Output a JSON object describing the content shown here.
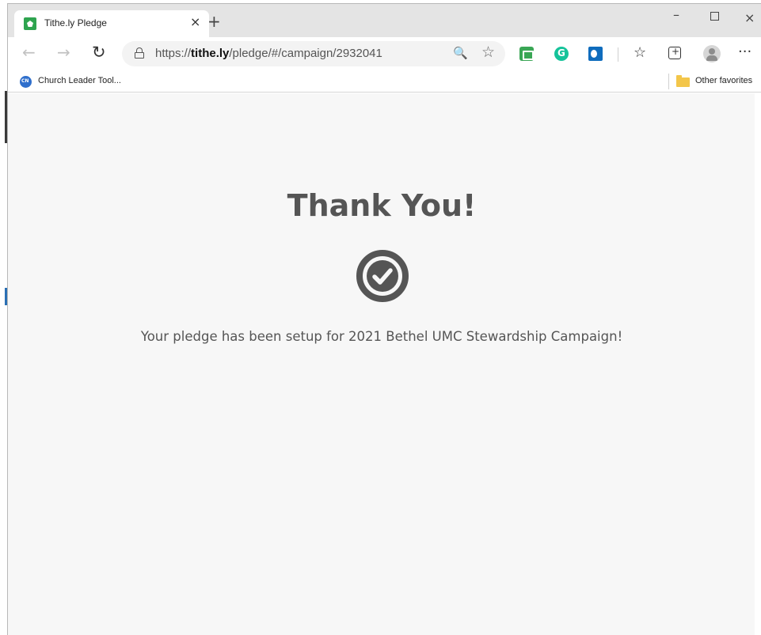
{
  "browser": {
    "tab_title": "Tithe.ly Pledge",
    "tab_close_glyph": "×",
    "new_tab_glyph": "+",
    "window_controls": {
      "minimize": "–",
      "close": "×"
    },
    "url_plain_prefix": "https://",
    "url_domain": "tithe.ly",
    "url_path": "/pledge/#/campaign/2932041",
    "nav": {
      "back_glyph": "←",
      "forward_glyph": "→",
      "refresh_glyph": "↻"
    },
    "address_icons": {
      "zoom": "zoom-icon",
      "favorite": "star-icon"
    },
    "zoom_glyph": "🔍",
    "star_glyph": "☆",
    "favorites_glyph": "☆",
    "more_glyph": "···",
    "extensions": [
      "print-friendly-icon",
      "grammarly-icon",
      "outlook-icon"
    ],
    "favorites_bar": {
      "items": [
        {
          "label": "Church Leader Tool..."
        }
      ],
      "other_label": "Other favorites"
    }
  },
  "page": {
    "heading": "Thank You!",
    "message": "Your pledge has been setup for 2021 Bethel UMC Stewardship Campaign!",
    "icon": "check-circle-icon",
    "colors": {
      "text": "#555555",
      "background": "#f7f7f7",
      "favicon": "#2ea44f"
    }
  }
}
